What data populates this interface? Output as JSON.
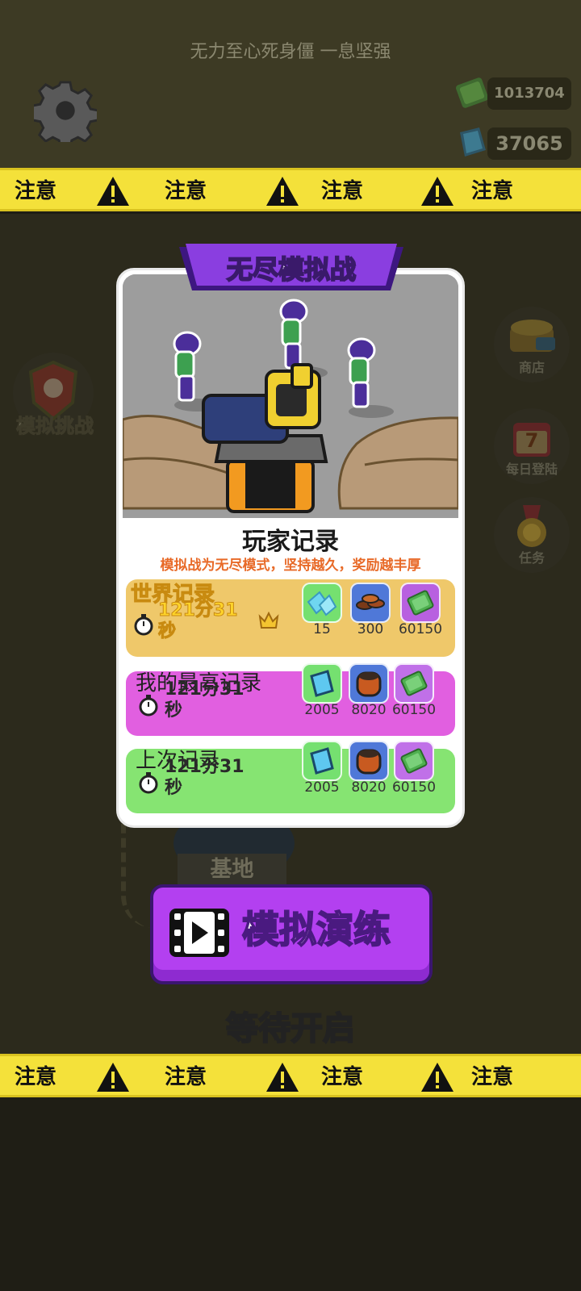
{
  "header": {
    "subtitle": "无力至心死身僵 一息坚强"
  },
  "resources": {
    "cash": "1013704",
    "gems": "37065"
  },
  "caution_tape": {
    "label": "注意"
  },
  "side_menu": {
    "simulate_challenge": "模拟挑战",
    "shop": "商店",
    "daily_login": "每日登陆",
    "daily_login_day": "7",
    "tasks": "任务"
  },
  "map": {
    "base_label": "基地"
  },
  "card": {
    "title": "无尽模拟战",
    "records_title": "玩家记录",
    "records_subtitle": "模拟战为无尽模式，坚持越久，奖励越丰厚",
    "rows": [
      {
        "label": "世界记录",
        "time": "121分31秒",
        "rewards": [
          "15",
          "300",
          "60150"
        ]
      },
      {
        "label": "我的最高记录",
        "time": "121分31秒",
        "rewards": [
          "2005",
          "8020",
          "60150"
        ]
      },
      {
        "label": "上次记录",
        "time": "121分31秒",
        "rewards": [
          "2005",
          "8020",
          "60150"
        ]
      }
    ]
  },
  "actions": {
    "play_label": "模拟演练",
    "status": "等待开启"
  },
  "colors": {
    "tape_yellow": "#f4e13a",
    "world_row": "#efc86a",
    "best_row": "#e15fe0",
    "last_row": "#86e472",
    "play_button": "#b340f0",
    "subtitle_orange": "#e86a28"
  }
}
